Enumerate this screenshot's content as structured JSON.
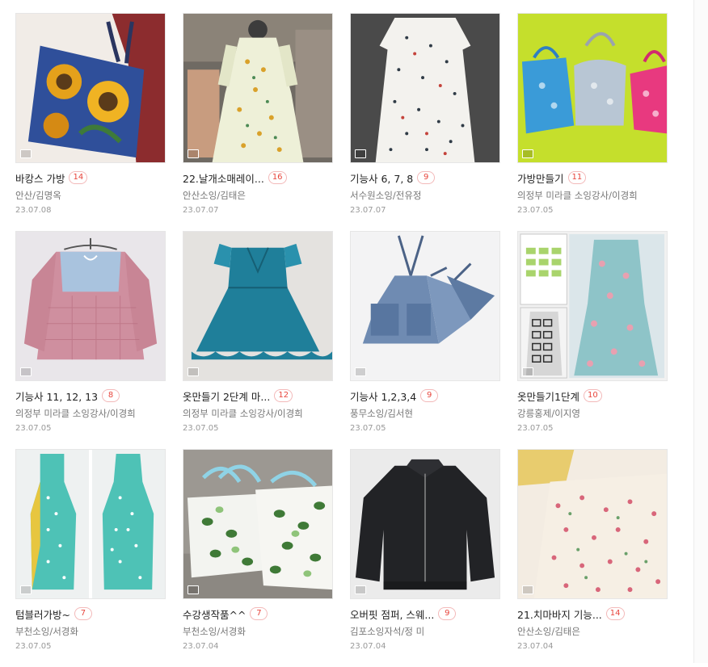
{
  "posts": [
    {
      "title": "바캉스 가방",
      "count": "14",
      "author": "안산/김명옥",
      "date": "23.07.08",
      "image": "sunflower-tote-bag"
    },
    {
      "title": "22.날개소매레이...",
      "count": "16",
      "author": "안산소잉/김태은",
      "date": "23.07.07",
      "image": "floral-dress-on-mannequin"
    },
    {
      "title": "기능사 6, 7, 8",
      "count": "9",
      "author": "서수원소잉/전유정",
      "date": "23.07.07",
      "image": "floral-nightgown"
    },
    {
      "title": "가방만들기",
      "count": "11",
      "author": "의정부 미라클 소잉강사/이경희",
      "date": "23.07.05",
      "image": "drawstring-bags"
    },
    {
      "title": "기능사 11, 12, 13",
      "count": "8",
      "author": "의정부 미라클 소잉강사/이경희",
      "date": "23.07.05",
      "image": "gingham-blouse"
    },
    {
      "title": "옷만들기 2단계 마...",
      "count": "12",
      "author": "의정부 미라클 소잉강사/이경희",
      "date": "23.07.05",
      "image": "teal-ruffle-dress"
    },
    {
      "title": "기능사 1,2,3,4",
      "count": "9",
      "author": "풍무소잉/김서현",
      "date": "23.07.05",
      "image": "denim-apron"
    },
    {
      "title": "옷만들기1단계",
      "count": "10",
      "author": "강릉홍제/이지영",
      "date": "23.07.05",
      "image": "mint-floral-dress"
    },
    {
      "title": "텀블러가방~",
      "count": "7",
      "author": "부천소잉/서경화",
      "date": "23.07.05",
      "image": "polka-dot-tumbler-bag"
    },
    {
      "title": "수강생작품^^",
      "count": "7",
      "author": "부천소잉/서경화",
      "date": "23.07.04",
      "image": "leaf-print-bags"
    },
    {
      "title": "오버핏 점퍼, 스웨...",
      "count": "9",
      "author": "김포소잉자석/정 미",
      "date": "23.07.04",
      "image": "black-zip-jumper"
    },
    {
      "title": "21.치마바지 기능...",
      "count": "14",
      "author": "안산소잉/김태은",
      "date": "23.07.04",
      "image": "floral-culottes"
    }
  ]
}
